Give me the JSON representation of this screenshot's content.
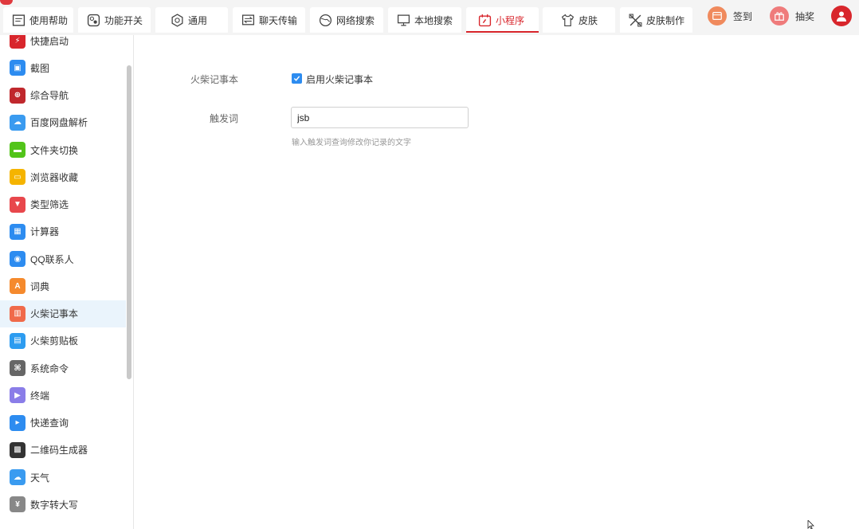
{
  "tabs": [
    {
      "label": "使用帮助",
      "icon": "help-doc-icon"
    },
    {
      "label": "功能开关",
      "icon": "toggle-icon"
    },
    {
      "label": "通用",
      "icon": "gear-icon"
    },
    {
      "label": "聊天传输",
      "icon": "chat-transfer-icon"
    },
    {
      "label": "网络搜索",
      "icon": "globe-icon"
    },
    {
      "label": "本地搜索",
      "icon": "monitor-icon"
    },
    {
      "label": "小程序",
      "icon": "calendar-app-icon"
    },
    {
      "label": "皮肤",
      "icon": "shirt-icon"
    },
    {
      "label": "皮肤制作",
      "icon": "tools-icon"
    }
  ],
  "active_tab": "小程序",
  "actions": {
    "signin": "签到",
    "lottery": "抽奖"
  },
  "sidebar": {
    "items": [
      {
        "label": "快捷启动",
        "color": "#d8262c"
      },
      {
        "label": "截图",
        "color": "#2d8cf0"
      },
      {
        "label": "综合导航",
        "color": "#c0282d"
      },
      {
        "label": "百度网盘解析",
        "color": "#3a9bf0"
      },
      {
        "label": "文件夹切换",
        "color": "#52c41a"
      },
      {
        "label": "浏览器收藏",
        "color": "#f5b400"
      },
      {
        "label": "类型筛选",
        "color": "#e8474c"
      },
      {
        "label": "计算器",
        "color": "#2d8cf0"
      },
      {
        "label": "QQ联系人",
        "color": "#2d8cf0"
      },
      {
        "label": "词典",
        "color": "#f58a2d"
      },
      {
        "label": "火柴记事本",
        "color": "#f06a4a"
      },
      {
        "label": "火柴剪贴板",
        "color": "#2d9cf0"
      },
      {
        "label": "系统命令",
        "color": "#666666"
      },
      {
        "label": "终端",
        "color": "#8a7de8"
      },
      {
        "label": "快递查询",
        "color": "#2d8cf0"
      },
      {
        "label": "二维码生成器",
        "color": "#333333"
      },
      {
        "label": "天气",
        "color": "#3a9bf0"
      },
      {
        "label": "数字转大写",
        "color": "#888888"
      }
    ],
    "active": "火柴记事本"
  },
  "form": {
    "enable_label": "火柴记事本",
    "enable_checkbox_label": "启用火柴记事本",
    "enable_checked": true,
    "trigger_label": "触发词",
    "trigger_value": "jsb",
    "trigger_hint": "输入触发词查询修改你记录的文字"
  },
  "colors": {
    "accent": "#d8262c",
    "checkbox": "#2d8cf0",
    "active_row": "#eaf4fc"
  }
}
